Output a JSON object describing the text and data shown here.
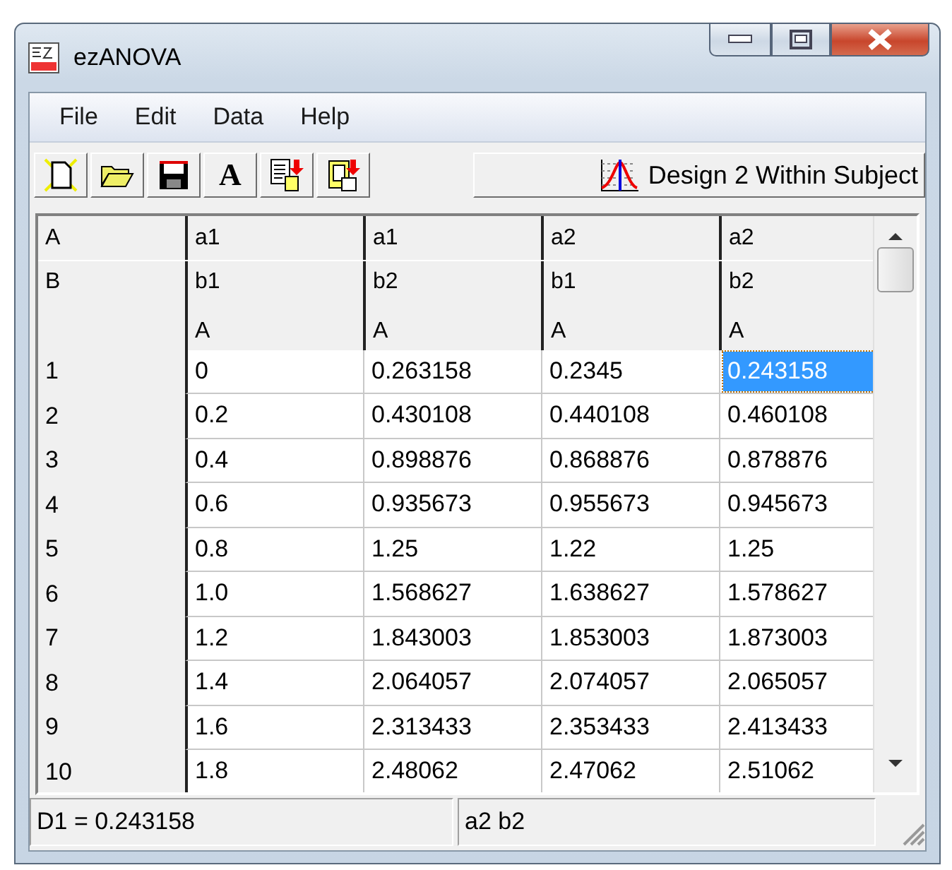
{
  "window": {
    "title": "ezANOVA"
  },
  "menu": [
    {
      "label": "File"
    },
    {
      "label": "Edit"
    },
    {
      "label": "Data"
    },
    {
      "label": "Help"
    }
  ],
  "toolbar": [
    {
      "kind": "new"
    },
    {
      "kind": "open"
    },
    {
      "kind": "save"
    },
    {
      "kind": "font",
      "glyph": "A"
    },
    {
      "kind": "export"
    },
    {
      "kind": "export_clip"
    }
  ],
  "design_button": {
    "label": "Design 2 Within Subject"
  },
  "grid": {
    "header_rows": [
      {
        "label": "A",
        "cells": [
          "a1",
          "a1",
          "a2",
          "a2"
        ]
      },
      {
        "label": "B",
        "cells": [
          "b1",
          "b2",
          "b1",
          "b2"
        ]
      },
      {
        "cells": [
          "A",
          "A",
          "A",
          "A"
        ]
      }
    ],
    "rows": [
      {
        "label": "1",
        "cells": [
          {
            "value": "0",
            "selected": false
          },
          {
            "value": "0.263158",
            "selected": false
          },
          {
            "value": "0.2345",
            "selected": false
          },
          {
            "value": "0.243158",
            "selected": true
          }
        ]
      },
      {
        "label": "2",
        "cells": [
          {
            "value": "0.2",
            "selected": false
          },
          {
            "value": "0.430108",
            "selected": false
          },
          {
            "value": "0.440108",
            "selected": false
          },
          {
            "value": "0.460108",
            "selected": false
          }
        ]
      },
      {
        "label": "3",
        "cells": [
          {
            "value": "0.4",
            "selected": false
          },
          {
            "value": "0.898876",
            "selected": false
          },
          {
            "value": "0.868876",
            "selected": false
          },
          {
            "value": "0.878876",
            "selected": false
          }
        ]
      },
      {
        "label": "4",
        "cells": [
          {
            "value": "0.6",
            "selected": false
          },
          {
            "value": "0.935673",
            "selected": false
          },
          {
            "value": "0.955673",
            "selected": false
          },
          {
            "value": "0.945673",
            "selected": false
          }
        ]
      },
      {
        "label": "5",
        "cells": [
          {
            "value": "0.8",
            "selected": false
          },
          {
            "value": "1.25",
            "selected": false
          },
          {
            "value": "1.22",
            "selected": false
          },
          {
            "value": "1.25",
            "selected": false
          }
        ]
      },
      {
        "label": "6",
        "cells": [
          {
            "value": "1.0",
            "selected": false
          },
          {
            "value": "1.568627",
            "selected": false
          },
          {
            "value": "1.638627",
            "selected": false
          },
          {
            "value": "1.578627",
            "selected": false
          }
        ]
      },
      {
        "label": "7",
        "cells": [
          {
            "value": "1.2",
            "selected": false
          },
          {
            "value": "1.843003",
            "selected": false
          },
          {
            "value": "1.853003",
            "selected": false
          },
          {
            "value": "1.873003",
            "selected": false
          }
        ]
      },
      {
        "label": "8",
        "cells": [
          {
            "value": "1.4",
            "selected": false
          },
          {
            "value": "2.064057",
            "selected": false
          },
          {
            "value": "2.074057",
            "selected": false
          },
          {
            "value": "2.065057",
            "selected": false
          }
        ]
      },
      {
        "label": "9",
        "cells": [
          {
            "value": "1.6",
            "selected": false
          },
          {
            "value": "2.313433",
            "selected": false
          },
          {
            "value": "2.353433",
            "selected": false
          },
          {
            "value": "2.413433",
            "selected": false
          }
        ]
      },
      {
        "label": "10",
        "cells": [
          {
            "value": "1.8",
            "selected": false
          },
          {
            "value": "2.48062",
            "selected": false
          },
          {
            "value": "2.47062",
            "selected": false
          },
          {
            "value": "2.51062",
            "selected": false
          }
        ]
      }
    ]
  },
  "status_bar": {
    "value": "D1 = 0.243158",
    "cell": "a2 b2"
  }
}
